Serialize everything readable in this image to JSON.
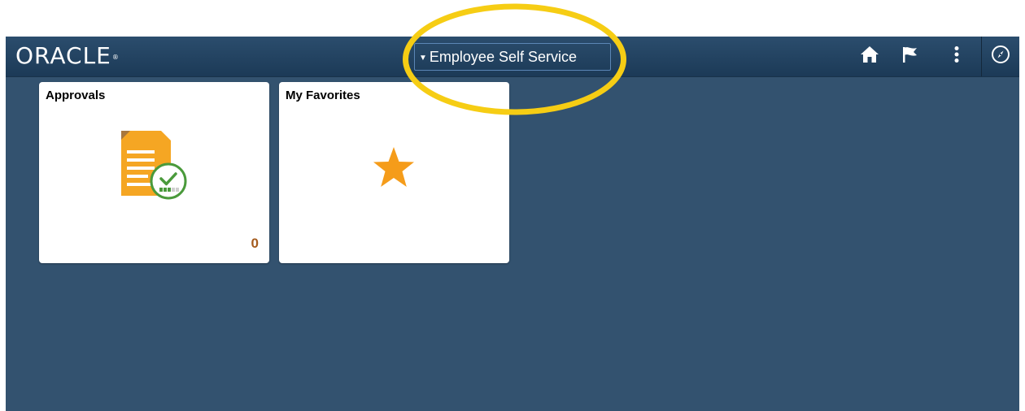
{
  "header": {
    "logo": "ORACLE",
    "logo_mark": "®",
    "homepage_selector": "Employee Self Service",
    "icons": {
      "home": "home-icon",
      "actions_list": "flag-icon",
      "menu": "more-vertical-icon",
      "navbar": "compass-icon"
    }
  },
  "tiles": [
    {
      "title": "Approvals",
      "count": "0",
      "icon": "approval-document-icon"
    },
    {
      "title": "My Favorites",
      "icon": "star-icon"
    }
  ],
  "colors": {
    "banner": "#1f3e5b",
    "background": "#33526f",
    "tile": "#ffffff",
    "accent_orange": "#f5a623",
    "count_color": "#a45a1c",
    "highlight_ring": "#f6cd14",
    "check_green": "#4a9a3b"
  }
}
